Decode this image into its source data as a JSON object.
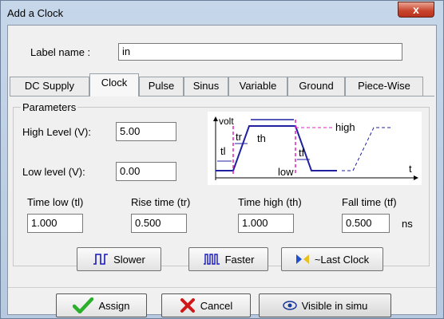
{
  "window": {
    "title": "Add a Clock",
    "close_label": "x"
  },
  "label_name": {
    "label": "Label name :",
    "value": "in"
  },
  "tabs": [
    {
      "label": "DC Supply"
    },
    {
      "label": "Clock"
    },
    {
      "label": "Pulse"
    },
    {
      "label": "Sinus"
    },
    {
      "label": "Variable"
    },
    {
      "label": "Ground"
    },
    {
      "label": "Piece-Wise"
    }
  ],
  "active_tab": "Clock",
  "parameters": {
    "title": "Parameters",
    "high_level": {
      "label": "High Level (V):",
      "value": "5.00"
    },
    "low_level": {
      "label": "Low level (V):",
      "value": "0.00"
    },
    "time_low": {
      "label": "Time low (tl)",
      "value": "1.000"
    },
    "rise_time": {
      "label": "Rise time (tr)",
      "value": "0.500"
    },
    "time_high": {
      "label": "Time high (th)",
      "value": "1.000"
    },
    "fall_time": {
      "label": "Fall time (tf)",
      "value": "0.500"
    },
    "unit": "ns"
  },
  "diagram": {
    "volt": "volt",
    "tl": "tl",
    "tr": "tr",
    "th": "th",
    "tf": "tf",
    "high": "high",
    "low": "low",
    "t": "t"
  },
  "speed_buttons": {
    "slower": "Slower",
    "faster": "Faster",
    "last_clock": "~Last Clock"
  },
  "bottom_buttons": {
    "assign": "Assign",
    "cancel": "Cancel",
    "visible": "Visible in simu"
  },
  "colors": {
    "accent_magenta": "#e020c0",
    "wave_blue": "#2020a0",
    "assign_green": "#2bb02b",
    "cancel_red": "#d01818"
  }
}
